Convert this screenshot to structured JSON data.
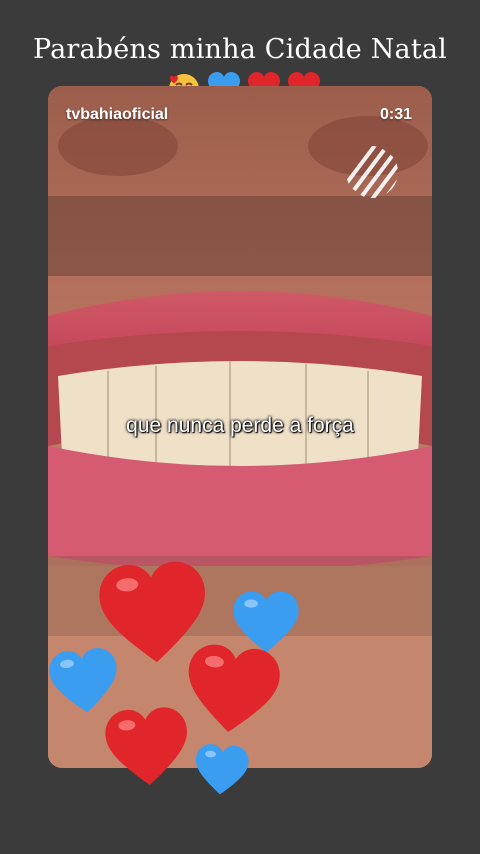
{
  "header": {
    "title": "Parabéns minha Cidade Natal",
    "emojis": [
      "smiling-face-with-hearts-icon",
      "blue-heart-icon",
      "red-heart-icon",
      "red-heart-icon"
    ]
  },
  "video": {
    "username": "tvbahiaoficial",
    "time": "0:31",
    "caption": "que nunca perde a força"
  },
  "colors": {
    "background": "#3b3b3b",
    "red_heart": "#e0262b",
    "blue_heart": "#3a9df0"
  },
  "stickers": [
    "red-heart-icon",
    "blue-heart-icon",
    "red-heart-icon",
    "blue-heart-icon",
    "red-heart-icon",
    "blue-heart-icon"
  ]
}
